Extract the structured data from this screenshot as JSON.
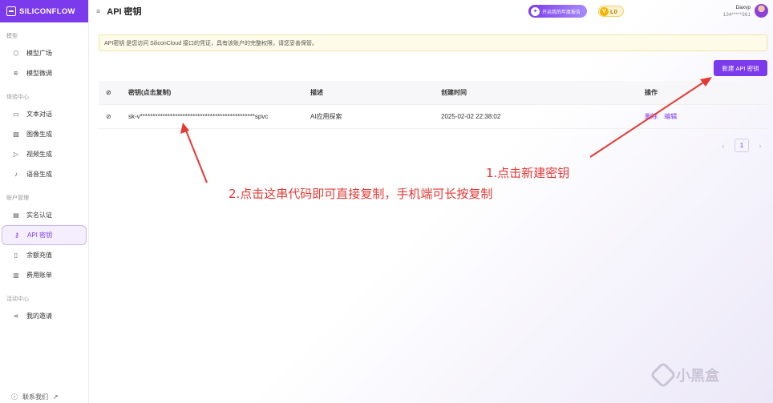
{
  "app": {
    "logo_text": "SILICONFLOW",
    "page_title": "API 密钥"
  },
  "sidebar": {
    "groups": [
      {
        "label": "模型",
        "items": [
          {
            "label": "模型广场",
            "icon": "cube-icon"
          },
          {
            "label": "模型微调",
            "icon": "tune-icon"
          }
        ]
      },
      {
        "label": "体验中心",
        "items": [
          {
            "label": "文本对话",
            "icon": "chat-icon"
          },
          {
            "label": "图像生成",
            "icon": "image-icon"
          },
          {
            "label": "视频生成",
            "icon": "video-icon"
          },
          {
            "label": "语音生成",
            "icon": "mic-icon"
          }
        ]
      },
      {
        "label": "账户管理",
        "items": [
          {
            "label": "实名认证",
            "icon": "id-card-icon"
          },
          {
            "label": "API 密钥",
            "icon": "key-icon",
            "active": true
          },
          {
            "label": "余额充值",
            "icon": "wallet-icon"
          },
          {
            "label": "费用账单",
            "icon": "bill-icon"
          }
        ]
      },
      {
        "label": "活动中心",
        "items": [
          {
            "label": "我的邀请",
            "icon": "share-icon"
          }
        ]
      }
    ],
    "contact_label": "联系我们"
  },
  "header": {
    "report_label": "开启我的年度报告",
    "level_label": "L0",
    "user_name": "Daxvp",
    "user_phone": "134*****361"
  },
  "notice": "API密钥 是您访问 SiliconCloud 接口的凭证，具有该账户的完整权限，请您妥善保管。",
  "actions": {
    "new_key_label": "新建 API 密钥"
  },
  "table": {
    "columns": [
      "密钥(点击复制)",
      "描述",
      "创建时间",
      "操作"
    ],
    "rows": [
      {
        "key": "sk-v**********************************************spvc",
        "description": "AI应用探索",
        "created": "2025-02-02 22:38:02",
        "action_delete": "删除",
        "action_edit": "编辑"
      }
    ]
  },
  "pagination": {
    "current": "1"
  },
  "annotations": {
    "step1": "1.点击新建密钥",
    "step2": "2.点击这串代码即可直接复制，手机端可长按复制"
  },
  "watermark": "小黑盒",
  "colors": {
    "accent": "#7c3aed",
    "annotation": "#e53935",
    "notice_bg": "#fefbe8"
  }
}
